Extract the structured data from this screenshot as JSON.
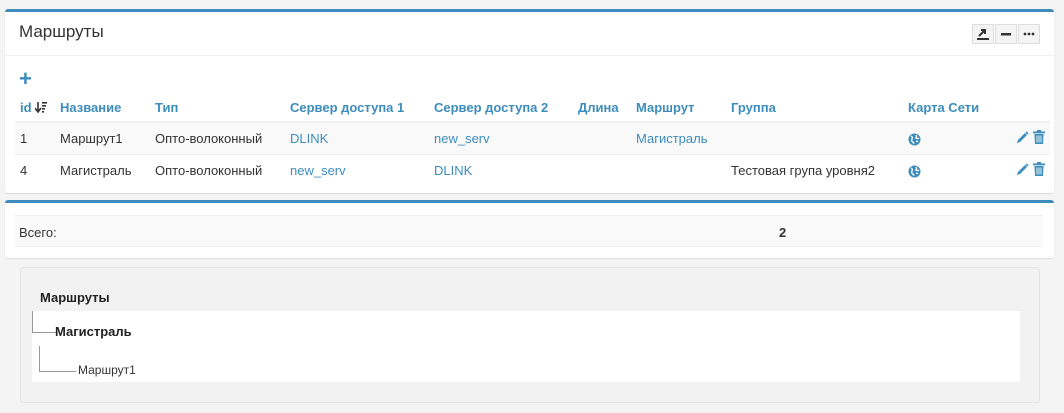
{
  "box1": {
    "title": "Маршруты",
    "add_label": "+",
    "headers": {
      "id": "id",
      "name": "Название",
      "type": "Тип",
      "server1": "Сервер доступа 1",
      "server2": "Сервер доступа 2",
      "length": "Длина",
      "route": "Маршрут",
      "group": "Группа",
      "map": "Карта Сети"
    },
    "rows": [
      {
        "id": "1",
        "name": "Маршрут1",
        "type": "Опто-волоконный",
        "server1": "DLINK",
        "server2": "new_serv",
        "length": "",
        "route": "Магистраль",
        "group": ""
      },
      {
        "id": "4",
        "name": "Магистраль",
        "type": "Опто-волоконный",
        "server1": "new_serv",
        "server2": "DLINK",
        "length": "",
        "route": "",
        "group": "Тестовая група уровня2"
      }
    ]
  },
  "summary": {
    "label": "Всего:",
    "value": "2"
  },
  "tree": {
    "root": "Маршруты",
    "level1": "Магистраль",
    "level2": "Маршрут1"
  },
  "colors": {
    "accent": "#3c8dbc"
  }
}
